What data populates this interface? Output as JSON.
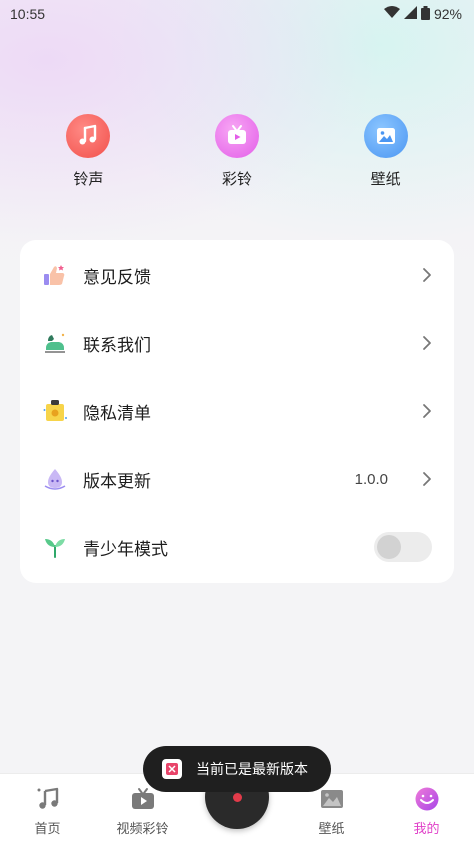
{
  "status_bar": {
    "time": "10:55",
    "battery": "92%",
    "icons": [
      "wifi-icon",
      "signal-icon",
      "battery-icon"
    ]
  },
  "quick_actions": [
    {
      "label": "铃声",
      "icon": "music-note-icon",
      "color": "#f2504b"
    },
    {
      "label": "彩铃",
      "icon": "tv-play-icon",
      "color": "#e35ee8"
    },
    {
      "label": "壁纸",
      "icon": "picture-icon",
      "color": "#4b96f2"
    }
  ],
  "menu": {
    "items": [
      {
        "label": "意见反馈",
        "icon": "thumbs-up-icon"
      },
      {
        "label": "联系我们",
        "icon": "phone-icon"
      },
      {
        "label": "隐私清单",
        "icon": "privacy-list-icon"
      },
      {
        "label": "版本更新",
        "icon": "update-icon",
        "value": "1.0.0"
      },
      {
        "label": "青少年模式",
        "icon": "sprout-icon",
        "toggle": false
      }
    ]
  },
  "toast": {
    "text": "当前已是最新版本"
  },
  "bottom_nav": {
    "items": [
      {
        "label": "首页",
        "icon": "music-notes-icon"
      },
      {
        "label": "视频彩铃",
        "icon": "tv-play-icon"
      },
      {
        "label": "壁纸",
        "icon": "picture-icon"
      },
      {
        "label": "我的",
        "icon": "smiley-icon",
        "active": true
      }
    ],
    "active_color": "#e040c8"
  }
}
